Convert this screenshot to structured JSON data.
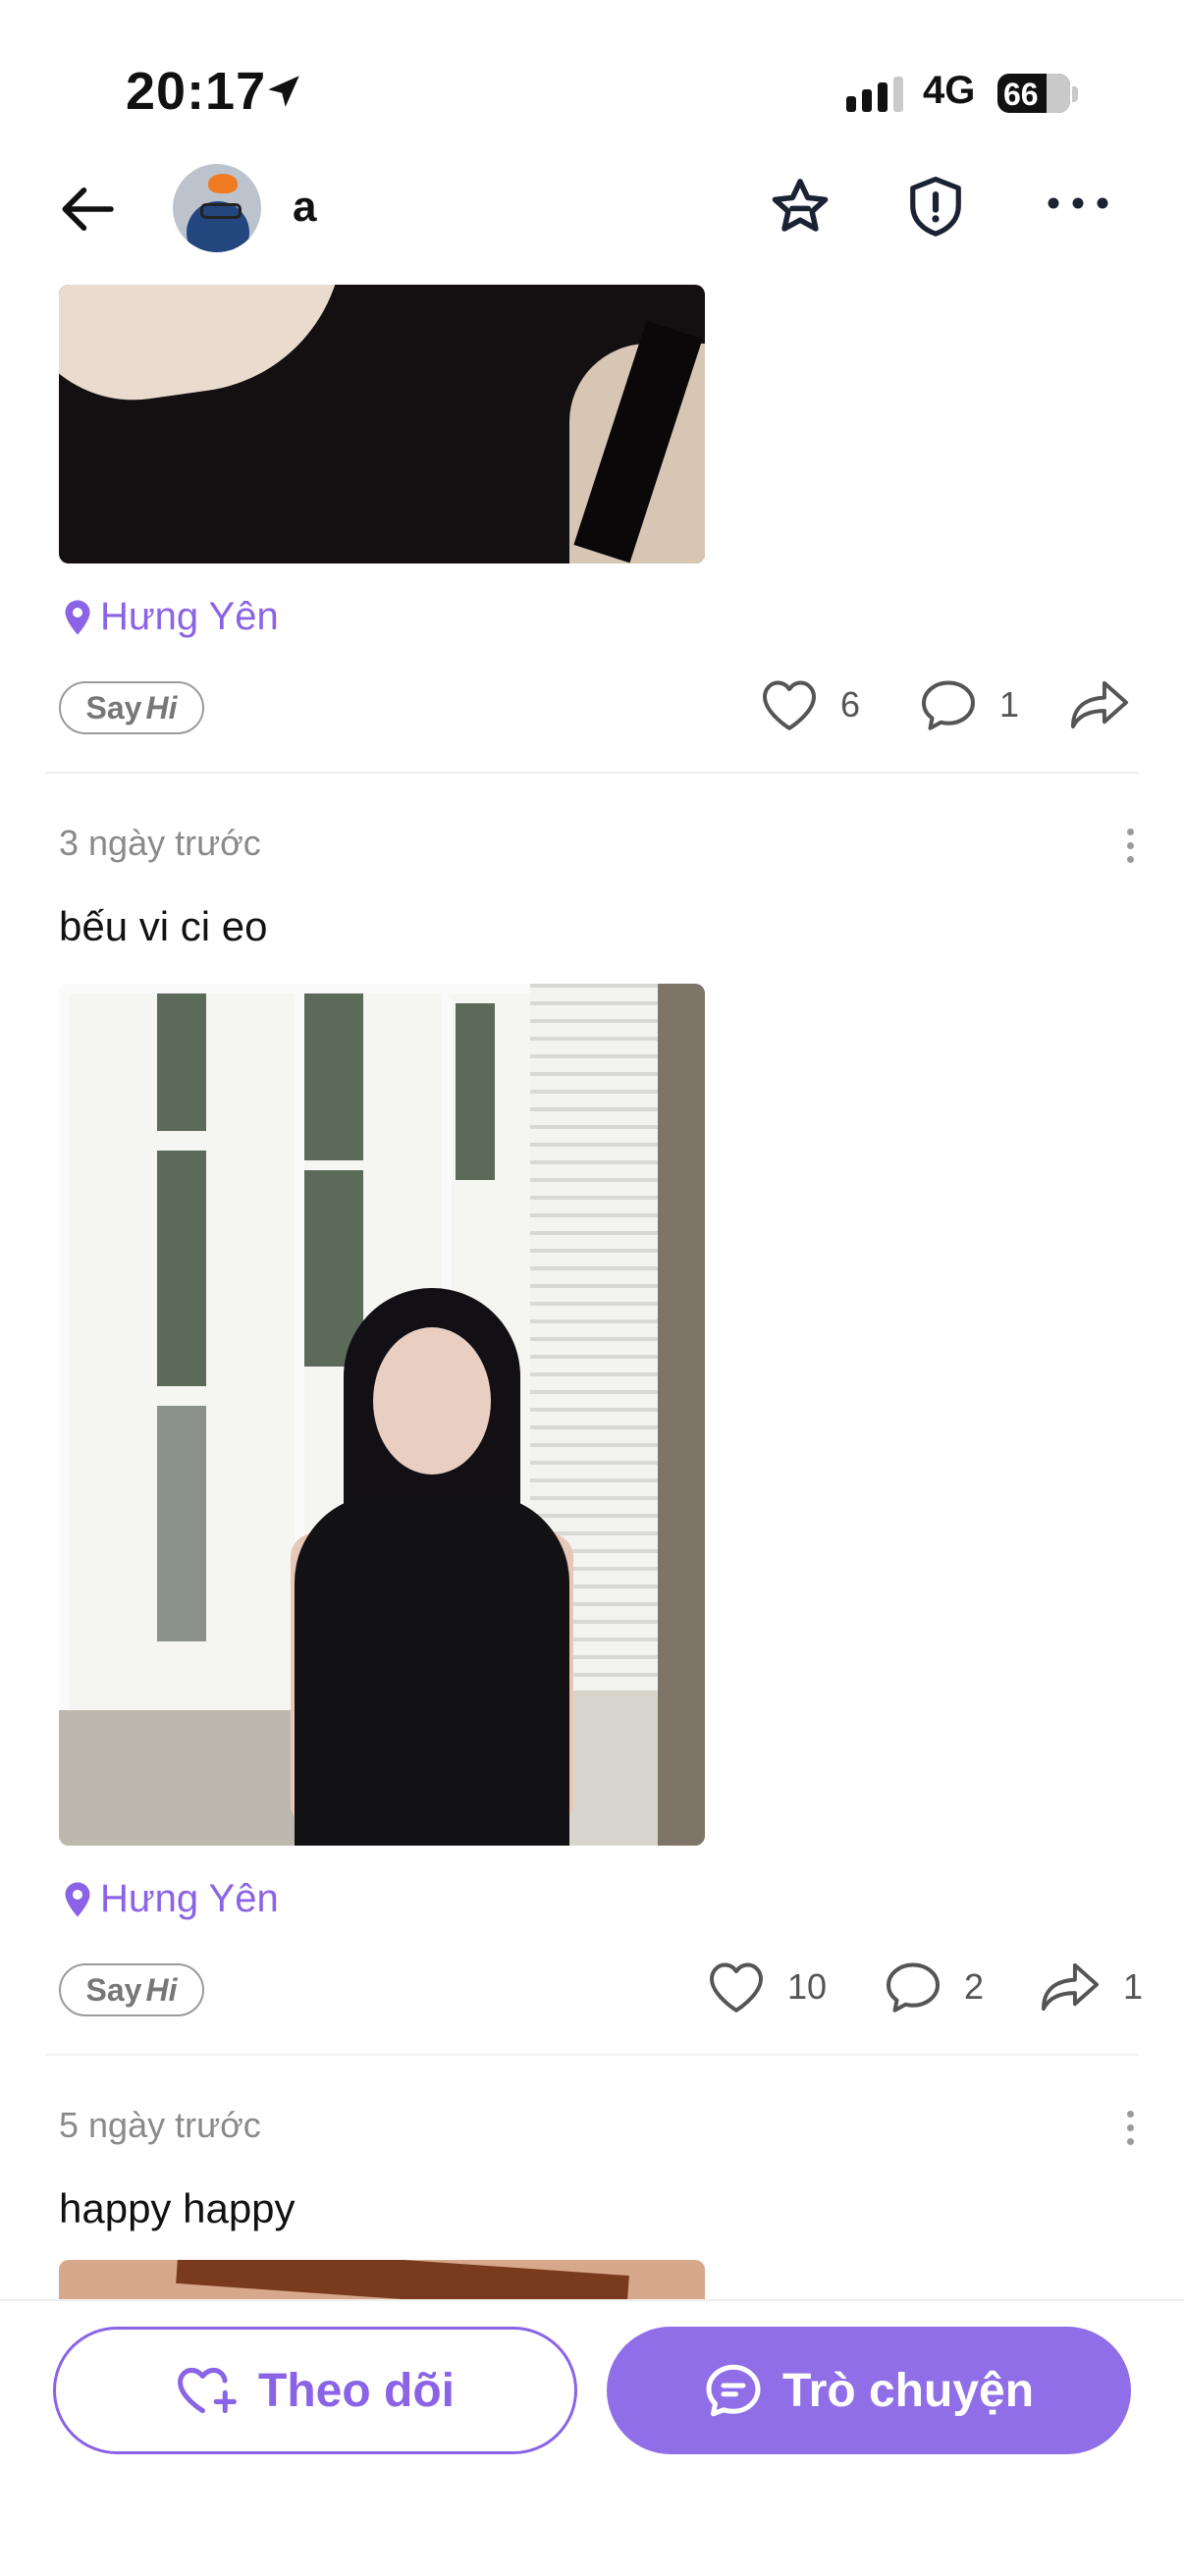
{
  "status_bar": {
    "time": "20:17",
    "network": "4G",
    "battery": "66"
  },
  "header": {
    "username": "a"
  },
  "posts": [
    {
      "location": "Hưng Yên",
      "sayhi": {
        "say": "Say",
        "hi": "Hi"
      },
      "likes": "6",
      "comments": "1",
      "shares": ""
    },
    {
      "time_ago": "3 ngày trước",
      "text": "bếu vi ci eo",
      "location": "Hưng Yên",
      "sayhi": {
        "say": "Say",
        "hi": "Hi"
      },
      "likes": "10",
      "comments": "2",
      "shares": "1"
    },
    {
      "time_ago": "5 ngày trước",
      "text": "happy happy"
    }
  ],
  "bottom_bar": {
    "follow_label": "Theo dõi",
    "chat_label": "Trò chuyện"
  },
  "colors": {
    "accent": "#8a63e6",
    "accent_fill": "#8f6ee8"
  }
}
